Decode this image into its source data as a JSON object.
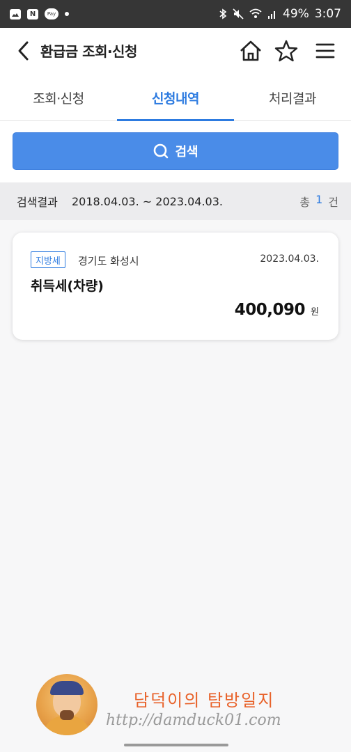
{
  "status_bar": {
    "time": "3:07",
    "battery": "49%",
    "left_icons": [
      "gallery-icon",
      "naver-icon",
      "pay-icon",
      "dot-icon"
    ],
    "naver_label": "N",
    "pay_label": "Pay",
    "right_icons": [
      "bluetooth-icon",
      "mute-icon",
      "wifi-icon",
      "signal-icon"
    ]
  },
  "header": {
    "title": "환급금 조회·신청",
    "icons": [
      "back-icon",
      "home-icon",
      "star-icon",
      "menu-icon"
    ]
  },
  "tabs": [
    {
      "label": "조회·신청",
      "active": false
    },
    {
      "label": "신청내역",
      "active": true
    },
    {
      "label": "처리결과",
      "active": false
    }
  ],
  "search": {
    "label": "검색",
    "icon": "search-icon"
  },
  "results": {
    "label": "검색결과",
    "range": "2018.04.03. ~ 2023.04.03.",
    "total_prefix": "총",
    "count": "1",
    "total_suffix": "건"
  },
  "items": [
    {
      "tag": "지방세",
      "region": "경기도 화성시",
      "date": "2023.04.03.",
      "title": "취득세(차량)",
      "amount": "400,090",
      "currency": "원"
    }
  ],
  "watermark": {
    "title": "담덕이의 탐방일지",
    "url": "http://damduck01.com"
  },
  "colors": {
    "accent": "#2d7be0",
    "search_button": "#4a8ce8",
    "status_bar": "#363636",
    "watermark_title": "#e8622a"
  }
}
